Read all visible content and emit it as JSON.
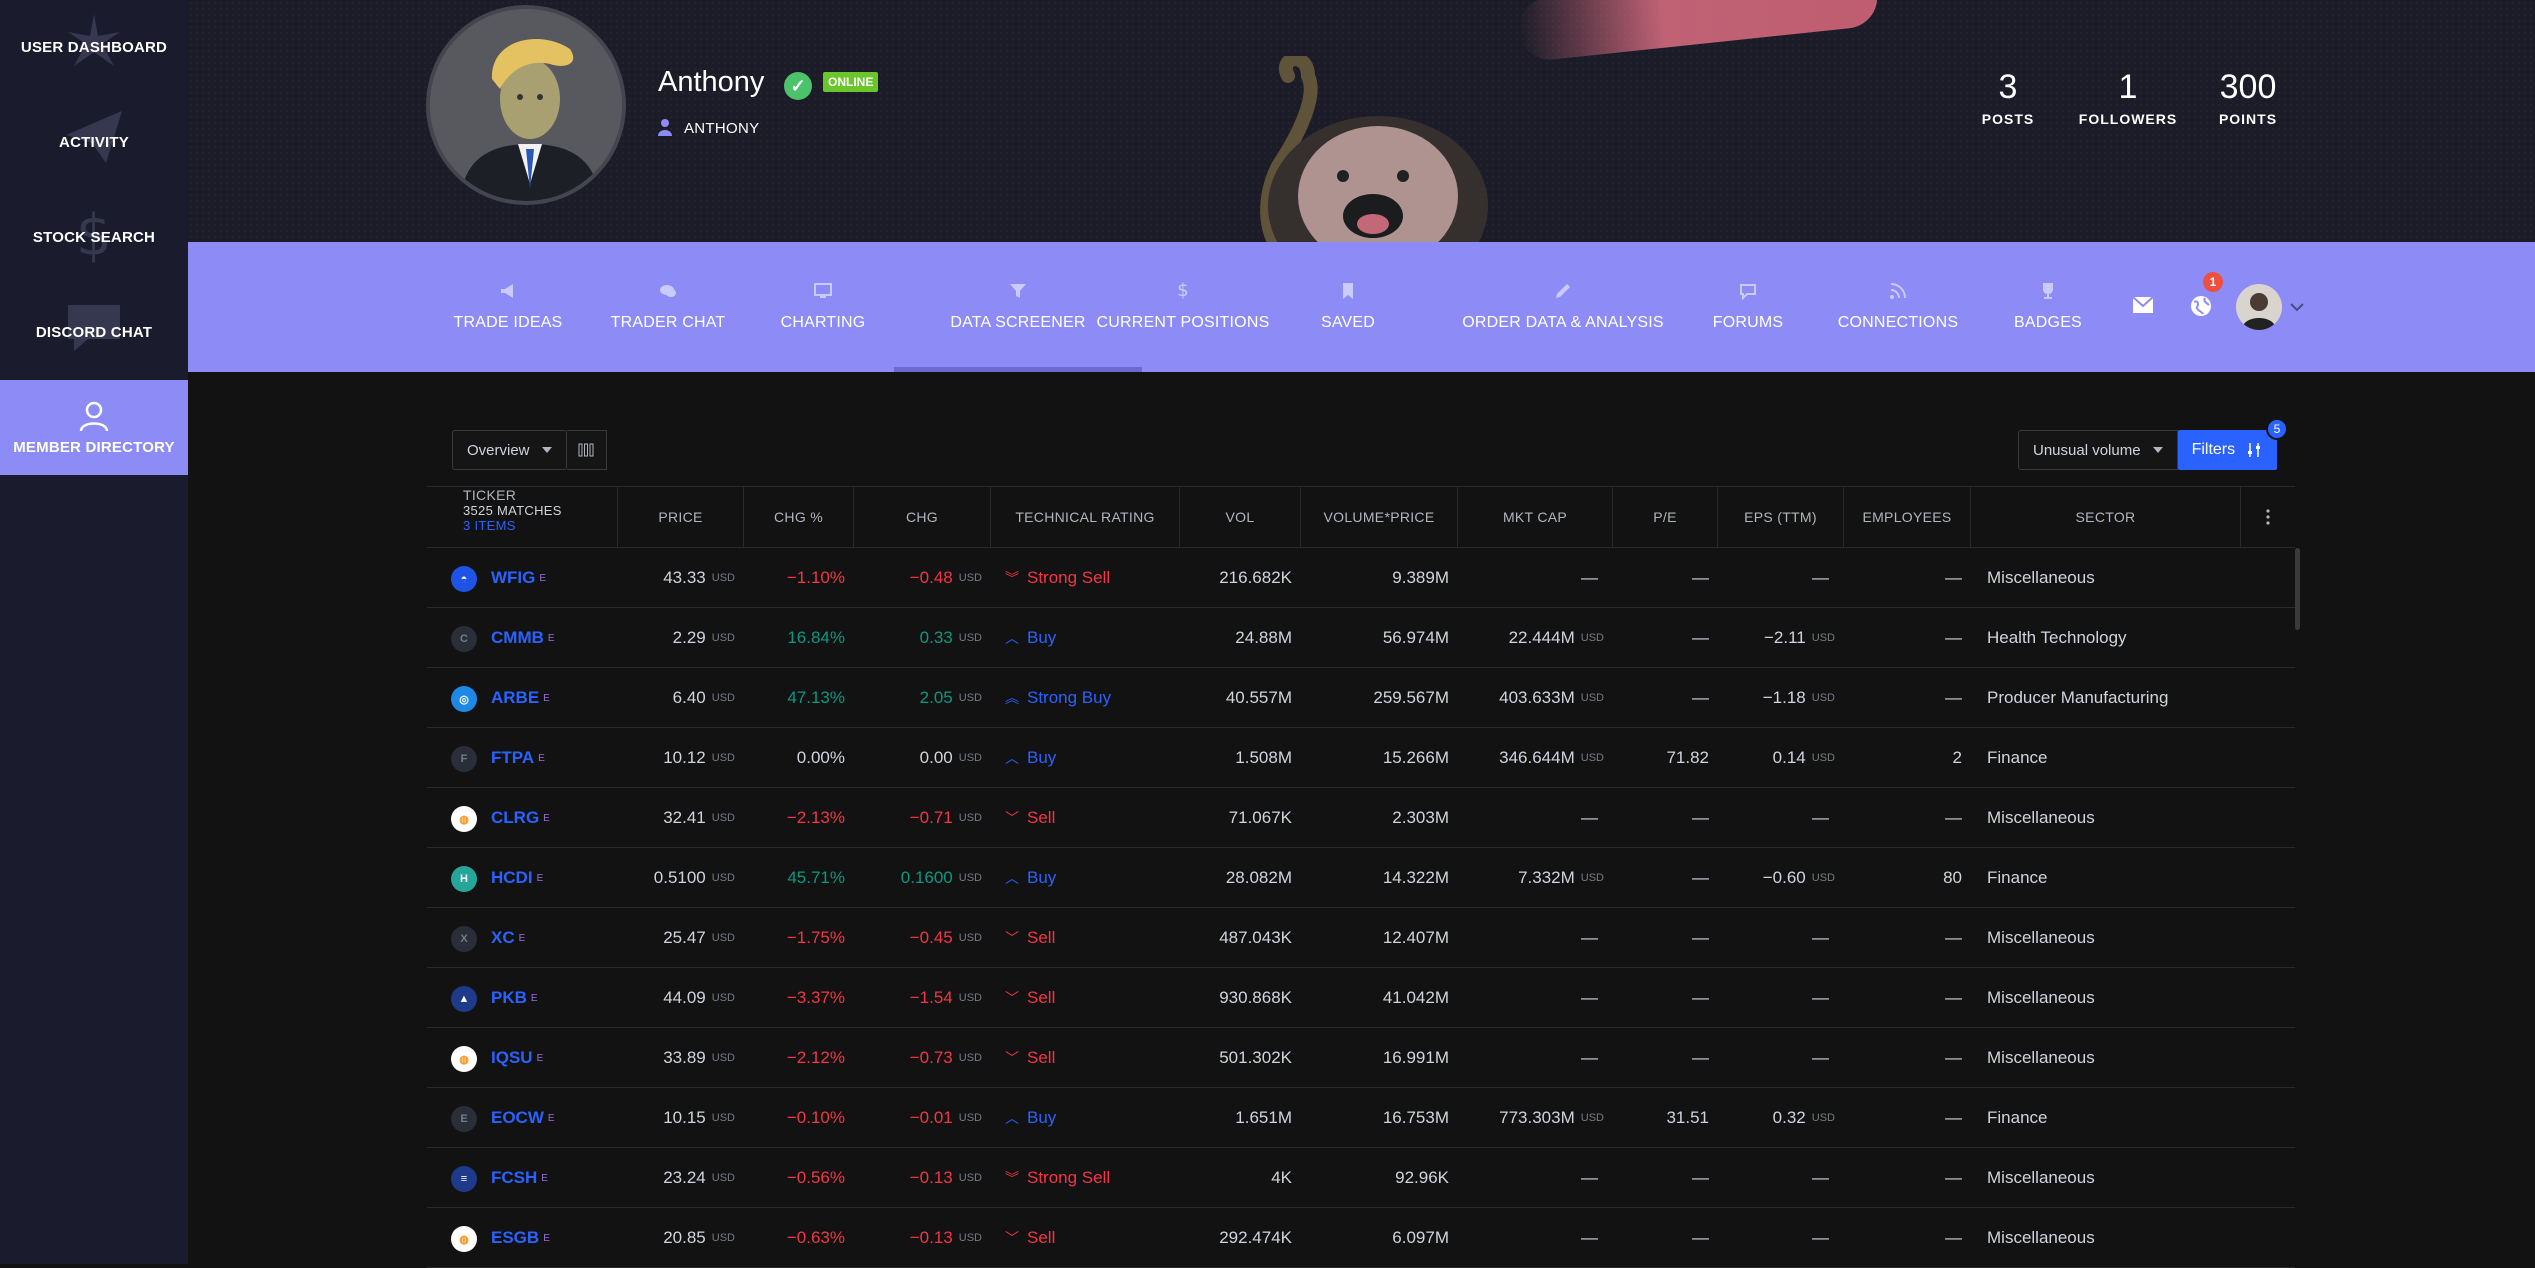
{
  "sidebar": {
    "items": [
      {
        "label": "USER DASHBOARD"
      },
      {
        "label": "ACTIVITY"
      },
      {
        "label": "STOCK SEARCH"
      },
      {
        "label": "DISCORD CHAT"
      },
      {
        "label": "MEMBER DIRECTORY"
      }
    ]
  },
  "profile": {
    "name": "Anthony",
    "status": "ONLINE",
    "handle": "ANTHONY",
    "stats": [
      {
        "value": "3",
        "label": "POSTS"
      },
      {
        "value": "1",
        "label": "FOLLOWERS"
      },
      {
        "value": "300",
        "label": "POINTS"
      }
    ]
  },
  "nav": {
    "items": [
      {
        "label": "TRADE IDEAS",
        "icon": "megaphone-icon"
      },
      {
        "label": "TRADER CHAT",
        "icon": "chat-bubbles-icon"
      },
      {
        "label": "CHARTING",
        "icon": "monitor-icon"
      },
      {
        "label": "DATA SCREENER",
        "icon": "filter-icon"
      },
      {
        "label": "CURRENT POSITIONS",
        "icon": "dollar-icon"
      },
      {
        "label": "SAVED",
        "icon": "bookmark-icon"
      },
      {
        "label": "ORDER DATA & ANALYSIS",
        "icon": "pencil-icon"
      },
      {
        "label": "FORUMS",
        "icon": "comments-icon"
      },
      {
        "label": "CONNECTIONS",
        "icon": "rss-icon"
      },
      {
        "label": "BADGES",
        "icon": "trophy-icon"
      }
    ],
    "notification_count": "1"
  },
  "screener": {
    "view_label": "Overview",
    "preset_label": "Unusual volume",
    "filters_label": "Filters",
    "filters_count": "5",
    "headers": {
      "ticker": "TICKER",
      "matches": "3525 MATCHES",
      "items": "3 ITEMS",
      "price": "PRICE",
      "chg_pct": "CHG %",
      "chg": "CHG",
      "rating": "TECHNICAL RATING",
      "vol": "VOL",
      "vol_price": "VOLUME*PRICE",
      "mkt_cap": "MKT CAP",
      "pe": "P/E",
      "eps": "EPS (TTM)",
      "employees": "EMPLOYEES",
      "sector": "SECTOR"
    },
    "unit": "USD",
    "rows": [
      {
        "logo": "",
        "ticker": "WFIG",
        "price": "43.33",
        "chg_pct": "−1.10%",
        "chg": "−0.48",
        "dir": "neg",
        "rating": "Strong Sell",
        "rating_dir": "sell",
        "vol": "216.682K",
        "vol_price": "9.389M",
        "mkt_cap": "—",
        "mkt_cap_unit": "",
        "pe": "—",
        "eps": "—",
        "eps_unit": "",
        "employees": "—",
        "sector": "Miscellaneous"
      },
      {
        "logo": "C",
        "ticker": "CMMB",
        "price": "2.29",
        "chg_pct": "16.84%",
        "chg": "0.33",
        "dir": "pos",
        "rating": "Buy",
        "rating_dir": "buy",
        "vol": "24.88M",
        "vol_price": "56.974M",
        "mkt_cap": "22.444M",
        "mkt_cap_unit": "USD",
        "pe": "—",
        "eps": "−2.11",
        "eps_unit": "USD",
        "employees": "—",
        "sector": "Health Technology"
      },
      {
        "logo": "",
        "ticker": "ARBE",
        "price": "6.40",
        "chg_pct": "47.13%",
        "chg": "2.05",
        "dir": "pos",
        "rating": "Strong Buy",
        "rating_dir": "buy",
        "vol": "40.557M",
        "vol_price": "259.567M",
        "mkt_cap": "403.633M",
        "mkt_cap_unit": "USD",
        "pe": "—",
        "eps": "−1.18",
        "eps_unit": "USD",
        "employees": "—",
        "sector": "Producer Manufacturing"
      },
      {
        "logo": "F",
        "ticker": "FTPA",
        "price": "10.12",
        "chg_pct": "0.00%",
        "chg": "0.00",
        "dir": "flat",
        "rating": "Buy",
        "rating_dir": "buy",
        "vol": "1.508M",
        "vol_price": "15.266M",
        "mkt_cap": "346.644M",
        "mkt_cap_unit": "USD",
        "pe": "71.82",
        "eps": "0.14",
        "eps_unit": "USD",
        "employees": "2",
        "sector": "Finance"
      },
      {
        "logo": "",
        "ticker": "CLRG",
        "price": "32.41",
        "chg_pct": "−2.13%",
        "chg": "−0.71",
        "dir": "neg",
        "rating": "Sell",
        "rating_dir": "sell",
        "vol": "71.067K",
        "vol_price": "2.303M",
        "mkt_cap": "—",
        "mkt_cap_unit": "",
        "pe": "—",
        "eps": "—",
        "eps_unit": "",
        "employees": "—",
        "sector": "Miscellaneous"
      },
      {
        "logo": "H",
        "ticker": "HCDI",
        "price": "0.5100",
        "chg_pct": "45.71%",
        "chg": "0.1600",
        "dir": "pos",
        "rating": "Buy",
        "rating_dir": "buy",
        "vol": "28.082M",
        "vol_price": "14.322M",
        "mkt_cap": "7.332M",
        "mkt_cap_unit": "USD",
        "pe": "—",
        "eps": "−0.60",
        "eps_unit": "USD",
        "employees": "80",
        "sector": "Finance"
      },
      {
        "logo": "X",
        "ticker": "XC",
        "price": "25.47",
        "chg_pct": "−1.75%",
        "chg": "−0.45",
        "dir": "neg",
        "rating": "Sell",
        "rating_dir": "sell",
        "vol": "487.043K",
        "vol_price": "12.407M",
        "mkt_cap": "—",
        "mkt_cap_unit": "",
        "pe": "—",
        "eps": "—",
        "eps_unit": "",
        "employees": "—",
        "sector": "Miscellaneous"
      },
      {
        "logo": "",
        "ticker": "PKB",
        "price": "44.09",
        "chg_pct": "−3.37%",
        "chg": "−1.54",
        "dir": "neg",
        "rating": "Sell",
        "rating_dir": "sell",
        "vol": "930.868K",
        "vol_price": "41.042M",
        "mkt_cap": "—",
        "mkt_cap_unit": "",
        "pe": "—",
        "eps": "—",
        "eps_unit": "",
        "employees": "—",
        "sector": "Miscellaneous"
      },
      {
        "logo": "",
        "ticker": "IQSU",
        "price": "33.89",
        "chg_pct": "−2.12%",
        "chg": "−0.73",
        "dir": "neg",
        "rating": "Sell",
        "rating_dir": "sell",
        "vol": "501.302K",
        "vol_price": "16.991M",
        "mkt_cap": "—",
        "mkt_cap_unit": "",
        "pe": "—",
        "eps": "—",
        "eps_unit": "",
        "employees": "—",
        "sector": "Miscellaneous"
      },
      {
        "logo": "E",
        "ticker": "EOCW",
        "price": "10.15",
        "chg_pct": "−0.10%",
        "chg": "−0.01",
        "dir": "neg",
        "rating": "Buy",
        "rating_dir": "buy",
        "vol": "1.651M",
        "vol_price": "16.753M",
        "mkt_cap": "773.303M",
        "mkt_cap_unit": "USD",
        "pe": "31.51",
        "eps": "0.32",
        "eps_unit": "USD",
        "employees": "—",
        "sector": "Finance"
      },
      {
        "logo": "",
        "ticker": "FCSH",
        "price": "23.24",
        "chg_pct": "−0.56%",
        "chg": "−0.13",
        "dir": "neg",
        "rating": "Strong Sell",
        "rating_dir": "sell",
        "vol": "4K",
        "vol_price": "92.96K",
        "mkt_cap": "—",
        "mkt_cap_unit": "",
        "pe": "—",
        "eps": "—",
        "eps_unit": "",
        "employees": "—",
        "sector": "Miscellaneous"
      },
      {
        "logo": "",
        "ticker": "ESGB",
        "price": "20.85",
        "chg_pct": "−0.63%",
        "chg": "−0.13",
        "dir": "neg",
        "rating": "Sell",
        "rating_dir": "sell",
        "vol": "292.474K",
        "vol_price": "6.097M",
        "mkt_cap": "—",
        "mkt_cap_unit": "",
        "pe": "—",
        "eps": "—",
        "eps_unit": "",
        "employees": "—",
        "sector": "Miscellaneous"
      }
    ]
  },
  "colors": {
    "accent": "#8d8cf7",
    "link": "#2962ff",
    "negative": "#f23645",
    "positive": "#089981"
  }
}
